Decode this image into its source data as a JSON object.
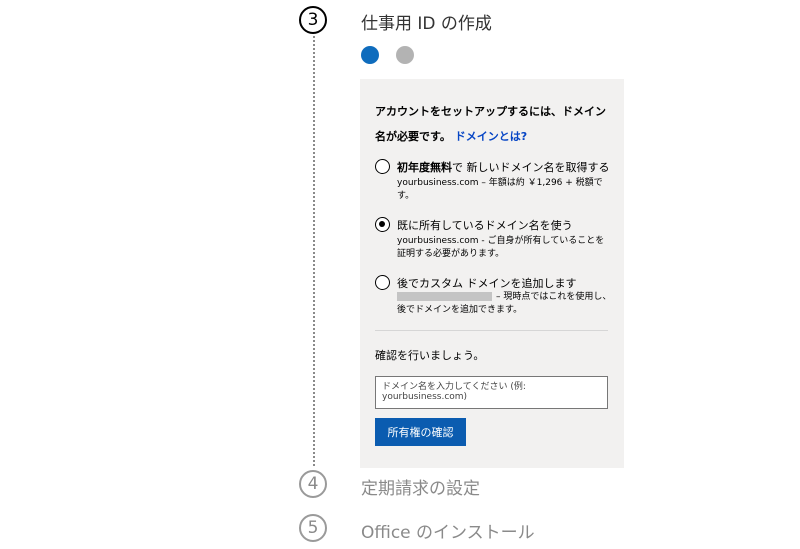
{
  "steps": [
    {
      "number": "3",
      "title": "仕事用 ID の作成",
      "state": "active"
    },
    {
      "number": "4",
      "title": "定期請求の設定",
      "state": "inactive"
    },
    {
      "number": "5",
      "title": "Office のインストール",
      "state": "inactive"
    }
  ],
  "progress": {
    "current": 1,
    "total": 2,
    "active_color": "#0f6cbd",
    "inactive_color": "#b3b3b3"
  },
  "domain_panel": {
    "intro_text": "アカウントをセットアップするには、ドメイン名が必要です。",
    "help_link": "ドメインとは?",
    "options": [
      {
        "title_bold": "初年度無料",
        "title_rest": "で 新しいドメイン名を取得する",
        "desc": "yourbusiness.com – 年額は約 ￥1,296 + 税額です。",
        "selected": false
      },
      {
        "title_bold": "",
        "title_rest": "既に所有しているドメイン名を使う",
        "desc": "yourbusiness.com - ご自身が所有していることを証明する必要があります。",
        "selected": true
      },
      {
        "title_bold": "",
        "title_rest": "後でカスタム ドメインを追加します",
        "desc": "– 現時点ではこれを使用し、後でドメインを追加できます。",
        "selected": false
      }
    ],
    "confirm_label": "確認を行いましょう。",
    "domain_input": {
      "placeholder": "ドメイン名を入力してください (例: yourbusiness.com)",
      "value": ""
    },
    "verify_button": "所有権の確認",
    "button_color": "#0b5cb0"
  }
}
